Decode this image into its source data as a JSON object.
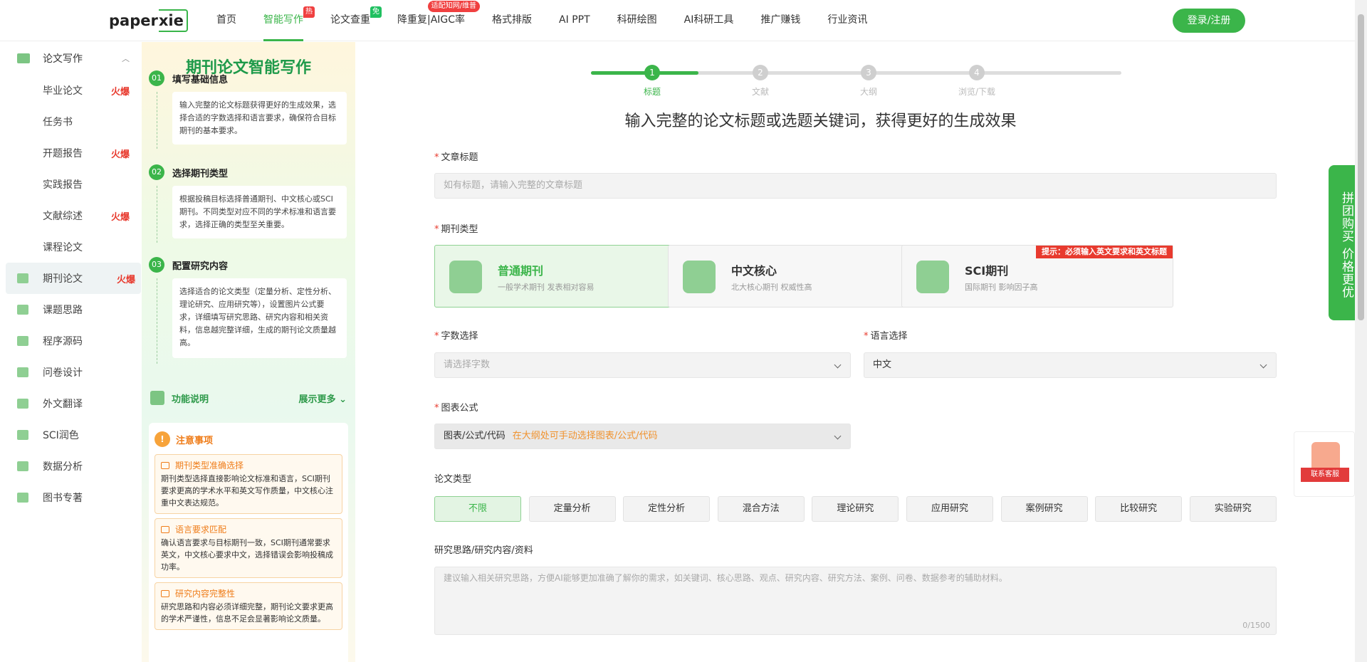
{
  "header": {
    "logo_main": "paper",
    "logo_box": "xie",
    "nav": [
      {
        "label": "首页",
        "badge": ""
      },
      {
        "label": "智能写作",
        "badge": "热",
        "active": true
      },
      {
        "label": "论文查重",
        "badge": "免"
      },
      {
        "label": "降重复|AIGC率",
        "badge": "适配知网/维普"
      },
      {
        "label": "格式排版",
        "badge": ""
      },
      {
        "label": "AI PPT",
        "badge": ""
      },
      {
        "label": "科研绘图",
        "badge": ""
      },
      {
        "label": "AI科研工具",
        "badge": ""
      },
      {
        "label": "推广赚钱",
        "badge": ""
      },
      {
        "label": "行业资讯",
        "badge": ""
      }
    ],
    "login": "登录/注册"
  },
  "sidebar": {
    "group": "论文写作",
    "sub_items": [
      {
        "label": "毕业论文",
        "hot": "火爆"
      },
      {
        "label": "任务书",
        "hot": ""
      },
      {
        "label": "开题报告",
        "hot": "火爆"
      },
      {
        "label": "实践报告",
        "hot": ""
      },
      {
        "label": "文献综述",
        "hot": "火爆"
      },
      {
        "label": "课程论文",
        "hot": ""
      }
    ],
    "items": [
      {
        "label": "期刊论文",
        "hot": "火爆",
        "active": true
      },
      {
        "label": "课题思路",
        "hot": ""
      },
      {
        "label": "程序源码",
        "hot": ""
      },
      {
        "label": "问卷设计",
        "hot": ""
      },
      {
        "label": "外文翻译",
        "hot": ""
      },
      {
        "label": "SCI润色",
        "hot": ""
      },
      {
        "label": "数据分析",
        "hot": ""
      },
      {
        "label": "图书专著",
        "hot": ""
      }
    ]
  },
  "guide": {
    "title": "期刊论文智能写作",
    "steps": [
      {
        "num": "01",
        "title": "填写基础信息",
        "text": "输入完整的论文标题获得更好的生成效果，选择合适的字数选择和语言要求，确保符合目标期刊的基本要求。"
      },
      {
        "num": "02",
        "title": "选择期刊类型",
        "text": "根据投稿目标选择普通期刊、中文核心或SCI期刊。不同类型对应不同的学术标准和语言要求，选择正确的类型至关重要。"
      },
      {
        "num": "03",
        "title": "配置研究内容",
        "text": "选择适合的论文类型（定量分析、定性分析、理论研究、应用研究等），设置图片公式要求，详细填写研究思路、研究内容和相关资料，信息越完整详细，生成的期刊论文质量越高。"
      }
    ],
    "func_label": "功能说明",
    "func_more": "展示更多",
    "notice_title": "注意事项",
    "notices": [
      {
        "title": "期刊类型准确选择",
        "text": "期刊类型选择直接影响论文标准和语言，SCI期刊要求更高的学术水平和英文写作质量，中文核心注重中文表达规范。"
      },
      {
        "title": "语言要求匹配",
        "text": "确认语言要求与目标期刊一致，SCI期刊通常要求英文，中文核心要求中文，选择错误会影响投稿成功率。"
      },
      {
        "title": "研究内容完整性",
        "text": "研究思路和内容必须详细完整，期刊论文要求更高的学术严谨性，信息不足会显著影响论文质量。"
      }
    ]
  },
  "progress": {
    "steps": [
      {
        "num": "1",
        "label": "标题"
      },
      {
        "num": "2",
        "label": "文献"
      },
      {
        "num": "3",
        "label": "大纲"
      },
      {
        "num": "4",
        "label": "浏览/下载"
      }
    ],
    "current": 1
  },
  "form": {
    "heading": "输入完整的论文标题或选题关键词，获得更好的生成效果",
    "title_label": "文章标题",
    "title_placeholder": "如有标题，请输入完整的文章标题",
    "journal_label": "期刊类型",
    "journals": [
      {
        "name": "普通期刊",
        "sub": "一般学术期刊 发表相对容易",
        "selected": true
      },
      {
        "name": "中文核心",
        "sub": "北大核心期刊 权威性高"
      },
      {
        "name": "SCI期刊",
        "sub": "国际期刊 影响因子高",
        "tip": "提示：必须输入英文要求和英文标题"
      }
    ],
    "words_label": "字数选择",
    "words_placeholder": "请选择字数",
    "lang_label": "语言选择",
    "lang_value": "中文",
    "chart_label": "图表公式",
    "chart_value": "图表/公式/代码",
    "chart_hint": "在大纲处可手动选择图表/公式/代码",
    "type_label": "论文类型",
    "types": [
      "不限",
      "定量分析",
      "定性分析",
      "混合方法",
      "理论研究",
      "应用研究",
      "案例研究",
      "比较研究",
      "实验研究"
    ],
    "research_label": "研究思路/研究内容/资料",
    "research_placeholder": "建议输入相关研究思路，方便AI能够更加准确了解你的需求，如关键词、核心思路、观点、研究内容、研究方法、案例、问卷、数据参考的辅助材料。",
    "counter": "0/1500"
  },
  "float": {
    "groupbuy": "拼团购买 价格更优",
    "service": "联系客服"
  },
  "colors": {
    "accent": "#3bb54a",
    "hot": "#e83a2e",
    "notice": "#ef7d1a"
  }
}
